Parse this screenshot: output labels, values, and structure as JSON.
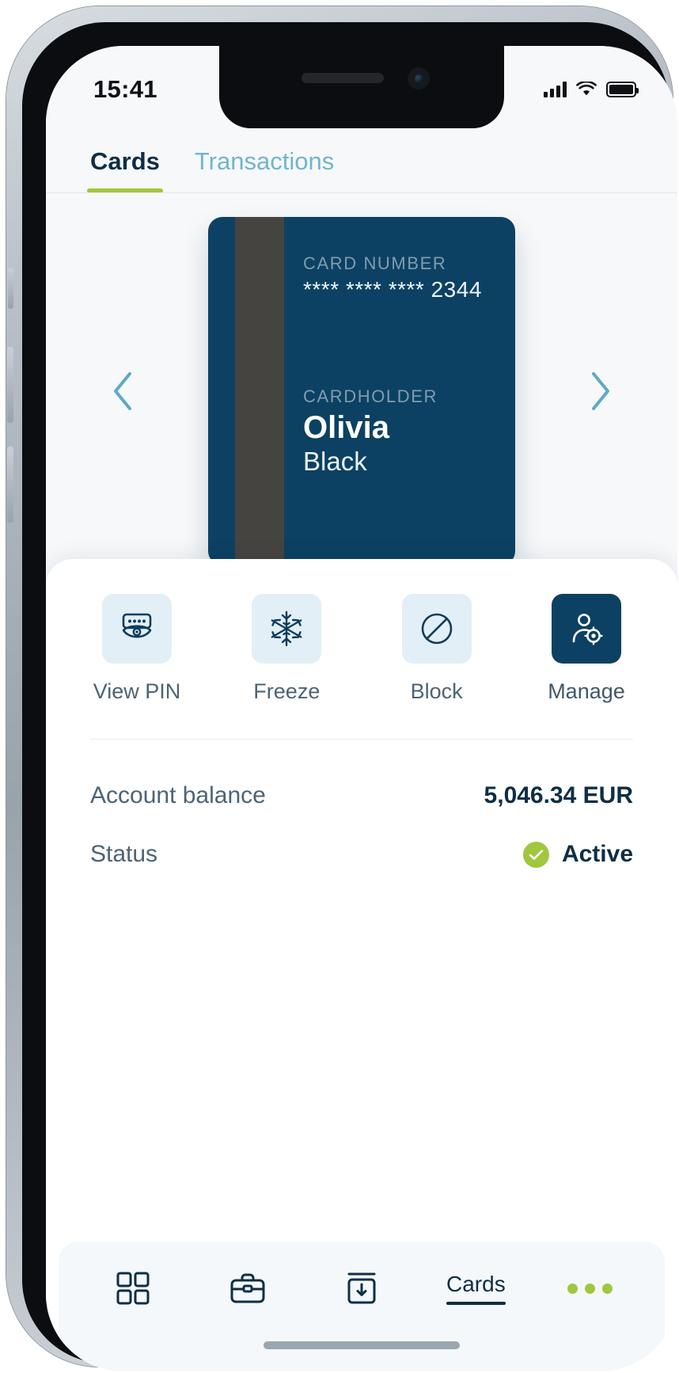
{
  "status_bar": {
    "time": "15:41",
    "cellular_icon": "signal-bars-icon",
    "wifi_icon": "wifi-icon",
    "battery_icon": "battery-full-icon"
  },
  "tabs": [
    {
      "label": "Cards",
      "active": true
    },
    {
      "label": "Transactions",
      "active": false
    }
  ],
  "carousel": {
    "prev_icon": "chevron-left-icon",
    "next_icon": "chevron-right-icon"
  },
  "card": {
    "card_number_label": "CARD NUMBER",
    "card_number": "**** **** **** 2344",
    "cardholder_label": "CARDHOLDER",
    "cardholder_first_name": "Olivia",
    "cardholder_last_name": "Black",
    "background_color": "#0c4163",
    "stripe_color": "#464441"
  },
  "actions": [
    {
      "label": "View PIN",
      "icon": "pin-eye-icon",
      "primary": false
    },
    {
      "label": "Freeze",
      "icon": "snowflake-icon",
      "primary": false
    },
    {
      "label": "Block",
      "icon": "block-circle-slash-icon",
      "primary": false
    },
    {
      "label": "Manage",
      "icon": "user-gear-icon",
      "primary": true
    }
  ],
  "details": {
    "balance_label": "Account balance",
    "balance_value": "5,046.34 EUR",
    "status_label": "Status",
    "status_value": "Active",
    "status_icon": "check-circle-icon",
    "status_color": "#9fc73f"
  },
  "bottom_nav": [
    {
      "label": "",
      "icon": "grid-icon",
      "active": false
    },
    {
      "label": "",
      "icon": "briefcase-icon",
      "active": false
    },
    {
      "label": "",
      "icon": "atm-deposit-icon",
      "active": false
    },
    {
      "label": "Cards",
      "icon": "",
      "active": true
    },
    {
      "label": "",
      "icon": "more-dots-icon",
      "active": false
    }
  ],
  "theme": {
    "accent_green": "#9fc73f",
    "brand_navy": "#0c4163",
    "tab_inactive": "#6fb6cc",
    "tile_bg": "#e3eff6"
  }
}
